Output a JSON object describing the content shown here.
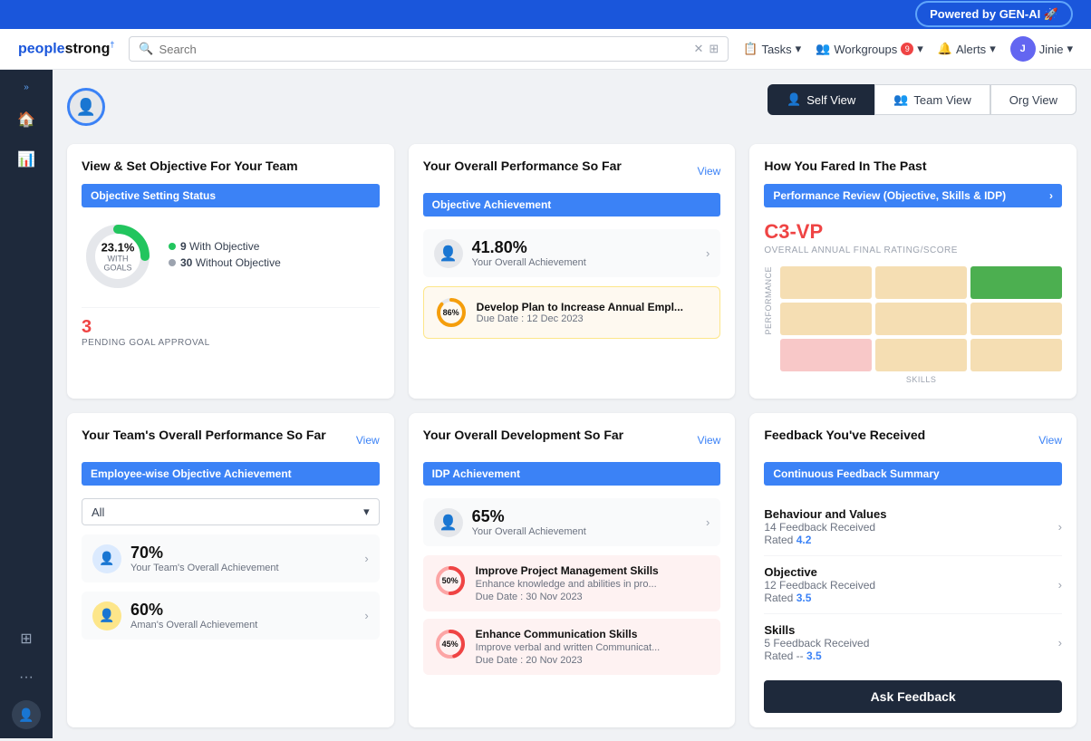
{
  "banner": {
    "text": "Powered by GEN-AI 🚀"
  },
  "header": {
    "logo": "peoplestrong",
    "search_placeholder": "Search",
    "tasks_label": "Tasks",
    "workgroups_label": "Workgroups",
    "alerts_label": "Alerts",
    "user_label": "Jinie",
    "workgroups_badge": "9"
  },
  "view_switcher": {
    "self": "Self View",
    "team": "Team View",
    "org": "Org View"
  },
  "objective_card": {
    "title": "View & Set Objective For Your Team",
    "bar_label": "Objective Setting Status",
    "percentage": "23.1%",
    "sub_label": "WITH GOALS",
    "with_obj_count": "9",
    "with_obj_label": "With Objective",
    "without_obj_count": "30",
    "without_obj_label": "Without Objective",
    "pending_num": "3",
    "pending_label": "PENDING GOAL APPROVAL"
  },
  "performance_card": {
    "title": "Your Overall Performance So Far",
    "view_link": "View",
    "bar_label": "Objective Achievement",
    "achievement_pct": "41.80%",
    "achievement_label": "Your Overall Achievement",
    "task_progress": "86%",
    "task_title": "Develop Plan to Increase Annual Empl...",
    "task_due": "Due Date : 12 Dec 2023"
  },
  "fared_card": {
    "title": "How You Fared In The Past",
    "bar_label": "Performance Review (Objective, Skills & IDP)",
    "rating_code": "C3-VP",
    "rating_sublabel": "OVERALL ANNUAL FINAL RATING/SCORE",
    "perf_label": "PERFORMANCE",
    "skills_label": "SKILLS",
    "matrix": [
      {
        "color": "#f5deb3",
        "active": false
      },
      {
        "color": "#f5deb3",
        "active": false
      },
      {
        "color": "#4caf50",
        "active": true
      },
      {
        "color": "#f5deb3",
        "active": false
      },
      {
        "color": "#f5deb3",
        "active": false
      },
      {
        "color": "#f5deb3",
        "active": false
      },
      {
        "color": "#f8c8c8",
        "active": false
      },
      {
        "color": "#f5deb3",
        "active": false
      },
      {
        "color": "#f5deb3",
        "active": false
      }
    ]
  },
  "team_perf_card": {
    "title": "Your Team's Overall Performance So Far",
    "view_link": "View",
    "bar_label": "Employee-wise Objective Achievement",
    "select_value": "All",
    "user1_pct": "70%",
    "user1_label": "Your Team's Overall Achievement",
    "user2_pct": "60%",
    "user2_label": "Aman's Overall Achievement"
  },
  "development_card": {
    "title": "Your Overall Development So Far",
    "view_link": "View",
    "bar_label": "IDP Achievement",
    "achievement_pct": "65%",
    "achievement_label": "Your Overall Achievement",
    "task1_progress": "50%",
    "task1_title": "Improve Project Management Skills",
    "task1_desc": "Enhance knowledge and abilities in pro...",
    "task1_due": "Due Date : 30 Nov 2023",
    "task2_progress": "45%",
    "task2_title": "Enhance Communication Skills",
    "task2_desc": "Improve verbal and written Communicat...",
    "task2_due": "Due Date : 20 Nov 2023"
  },
  "feedback_card": {
    "title": "Feedback You've Received",
    "view_link": "View",
    "bar_label": "Continuous Feedback Summary",
    "row1_label": "Behaviour and Values",
    "row1_count": "14 Feedback Received",
    "row1_rating": "Rated 4.2",
    "row2_label": "Objective",
    "row2_count": "12 Feedback Received",
    "row2_rating": "Rated 3.5",
    "row3_label": "Skills",
    "row3_count": "5 Feedback Received",
    "row3_rating": "Rated -- 3.5",
    "ask_btn": "Ask Feedback"
  }
}
